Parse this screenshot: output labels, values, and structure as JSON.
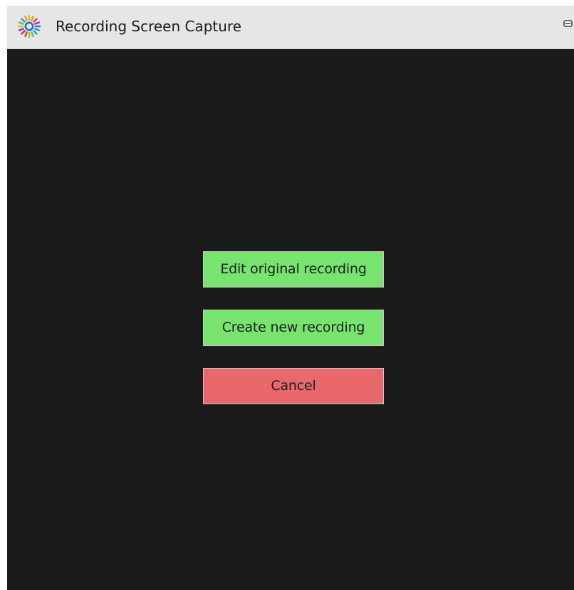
{
  "window": {
    "title": "Recording Screen Capture",
    "app_icon": "radiant-sun-logo-icon",
    "minimize_icon": "minimize-icon"
  },
  "dialog": {
    "buttons": [
      {
        "id": "edit-original-recording-button",
        "label": "Edit original recording",
        "color": "#77e470"
      },
      {
        "id": "create-new-recording-button",
        "label": "Create new recording",
        "color": "#77e470"
      },
      {
        "id": "cancel-button",
        "label": "Cancel",
        "color": "#e8686b"
      }
    ]
  },
  "colors": {
    "background": "#1b1b1b",
    "titlebar": "#e6e6e6",
    "confirm": "#77e470",
    "cancel": "#e8686b"
  }
}
